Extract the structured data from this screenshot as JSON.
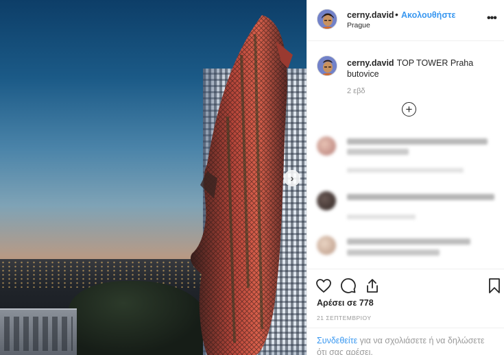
{
  "post": {
    "author": "cerny.david",
    "separator": "•",
    "follow_label": "Ακολουθήστε",
    "location": "Prague",
    "more_label": "•••",
    "caption_author": "cerny.david",
    "caption_text": "TOP TOWER Praha butovice",
    "caption_time": "2 εβδ",
    "load_more_icon": "plus-circle-icon",
    "likes_prefix": "Αρέσει σε",
    "likes_count": "778",
    "date": "21 ΣΕΠΤΕΜΒΡΙΟΥ",
    "login_link": "Συνδεθείτε",
    "login_rest": " για να σχολιάσετε ή να δηλώσετε ότι σας αρέσει."
  },
  "icons": {
    "like": "heart-icon",
    "comment": "comment-icon",
    "share": "share-icon",
    "save": "bookmark-icon",
    "next": "chevron-right-icon"
  },
  "colors": {
    "link_blue": "#3897f0",
    "text": "#262626",
    "muted": "#999999",
    "divider": "#efefef"
  }
}
